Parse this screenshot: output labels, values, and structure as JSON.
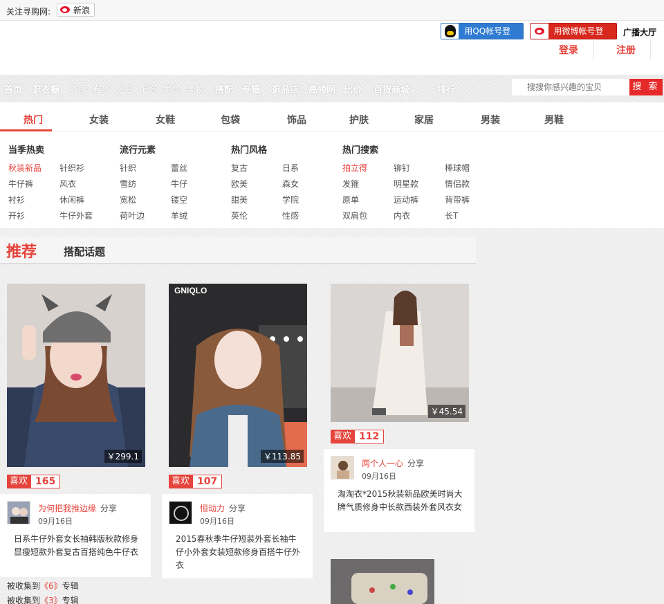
{
  "topbar": {
    "follow_label": "关注寻购网:",
    "weibo_label": "新浪"
  },
  "login": {
    "qq_label": "用QQ帐号登录",
    "weibo_label": "用微博帐号登录",
    "broadcast": "广播大厅",
    "login_link": "登录",
    "register_link": "注册"
  },
  "nav": {
    "items": [
      "首页",
      "逛衣橱",
      "衣服",
      "鞋子",
      "包包",
      "配饰",
      "家居",
      "美妆",
      "搭配",
      "专辑",
      "逛品店",
      "高领网",
      "比价",
      "百货商城",
      "排行"
    ]
  },
  "search": {
    "placeholder": "搜搜你感兴趣的宝贝",
    "button": "搜 索"
  },
  "categories": [
    "热门",
    "女装",
    "女鞋",
    "包袋",
    "饰品",
    "护肤",
    "家居",
    "男装",
    "男鞋"
  ],
  "panel": {
    "col1": {
      "title": "当季热卖",
      "links": [
        "秋装新品",
        "针织衫",
        "牛仔裤",
        "风衣",
        "衬衫",
        "休闲裤",
        "开衫",
        "牛仔外套"
      ]
    },
    "col2": {
      "title": "流行元素",
      "links": [
        "针织",
        "蕾丝",
        "雪纺",
        "牛仔",
        "宽松",
        "镂空",
        "荷叶边",
        "羊绒"
      ]
    },
    "col3": {
      "title": "热门风格",
      "links": [
        "复古",
        "日系",
        "欧美",
        "森女",
        "甜美",
        "学院",
        "英伦",
        "性感"
      ]
    },
    "col4": {
      "title": "热门搜索",
      "links": [
        "拍立得",
        "铆钉",
        "棒球帽",
        "发箍",
        "明星款",
        "情侣款",
        "原单",
        "运动裤",
        "背带裤",
        "双肩包",
        "内衣",
        "长T"
      ]
    }
  },
  "tabs": {
    "recommend": "推荐",
    "topic": "搭配话题"
  },
  "cards": [
    {
      "price": "￥299.1",
      "like_label": "喜欢",
      "likes": "165",
      "user": "为何把我推边缘",
      "action": "分享",
      "date": "09月16日",
      "desc": "日系牛仔外套女长袖韩版秋款修身显瘦短款外套复古百搭纯色牛仔衣",
      "collect1_pre": "被收集到",
      "collect1_num": "《6》",
      "collect1_post": "专辑",
      "collect2_pre": "被收集到",
      "collect2_num": "《3》",
      "collect2_post": "专辑"
    },
    {
      "price": "￥113.85",
      "like_label": "喜欢",
      "likes": "107",
      "user": "恒动力",
      "action": "分享",
      "date": "09月16日",
      "desc": "2015春秋季牛仔短装外套长袖牛仔小外套女装短款修身百搭牛仔外衣",
      "brand": "GNIQLO"
    },
    {
      "price": "￥45.54",
      "like_label": "喜欢",
      "likes": "112",
      "user": "两个人一心",
      "action": "分享",
      "date": "09月16日",
      "desc": "淘淘衣*2015秋装新品欧美时尚大牌气质修身中长款西装外套风衣女"
    }
  ],
  "colors": {
    "accent": "#e5433b",
    "qq": "#2e7bd1",
    "weibo": "#d8271c"
  }
}
